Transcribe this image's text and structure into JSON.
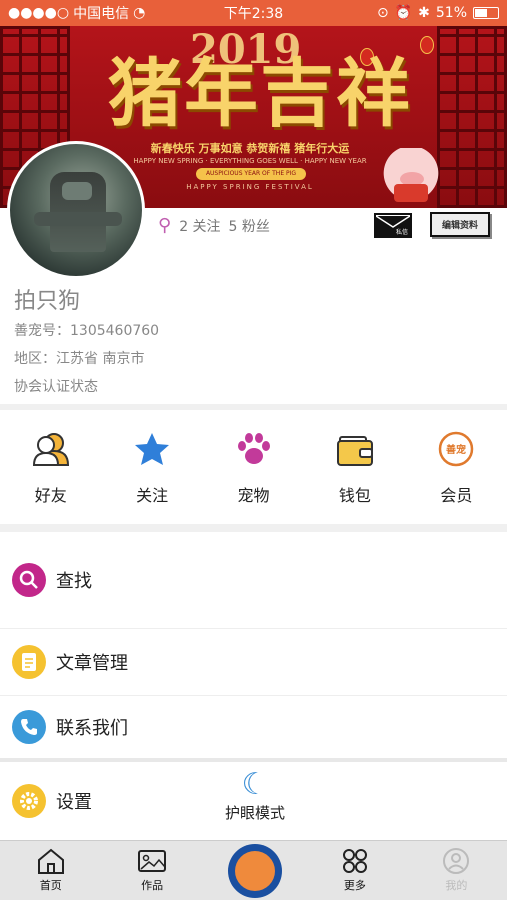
{
  "status": {
    "carrier": "中国电信",
    "time": "下午2:38",
    "battery": "51%"
  },
  "banner": {
    "title": "猪年吉祥",
    "year": "2019",
    "line1": "新春快乐 万事如意 恭贺新禧 猪年行大运",
    "line2": "HAPPY NEW SPRING · EVERYTHING GOES WELL · HAPPY NEW YEAR",
    "tag": "AUSPICIOUS YEAR OF THE PIG",
    "foot": "HAPPY SPRING FESTIVAL"
  },
  "profile": {
    "follow_count": "2 关注",
    "fans_count": "5 粉丝",
    "msg_label": "私信",
    "edit_label": "编辑资料",
    "name": "拍只狗",
    "pet_id": "善宠号：1305460760",
    "region": "地区：江苏省 南京市",
    "cert": "协会认证状态"
  },
  "quick": [
    {
      "label": "好友",
      "icon": "friends-icon"
    },
    {
      "label": "关注",
      "icon": "star-icon"
    },
    {
      "label": "宠物",
      "icon": "paw-icon"
    },
    {
      "label": "钱包",
      "icon": "wallet-icon"
    },
    {
      "label": "会员",
      "icon": "member-icon",
      "badge": "善宠"
    }
  ],
  "menu": [
    {
      "label": "查找",
      "icon": "search-icon",
      "color": "#c2278a"
    },
    {
      "label": "文章管理",
      "icon": "article-icon",
      "color": "#f5c230"
    },
    {
      "label": "联系我们",
      "icon": "phone-icon",
      "color": "#3a9ad9"
    },
    {
      "label": "设置",
      "icon": "gear-icon",
      "color": "#f5c230"
    }
  ],
  "eye_mode": "护眼模式",
  "tabs": [
    {
      "label": "首页",
      "icon": "home-icon"
    },
    {
      "label": "作品",
      "icon": "gallery-icon"
    },
    {
      "label": "",
      "icon": "center-action-icon"
    },
    {
      "label": "更多",
      "icon": "grid-icon"
    },
    {
      "label": "我的",
      "icon": "profile-icon"
    }
  ],
  "colors": {
    "status_bar": "#e8603a",
    "banner": "#b4141a",
    "accent": "#3b8fd6"
  }
}
